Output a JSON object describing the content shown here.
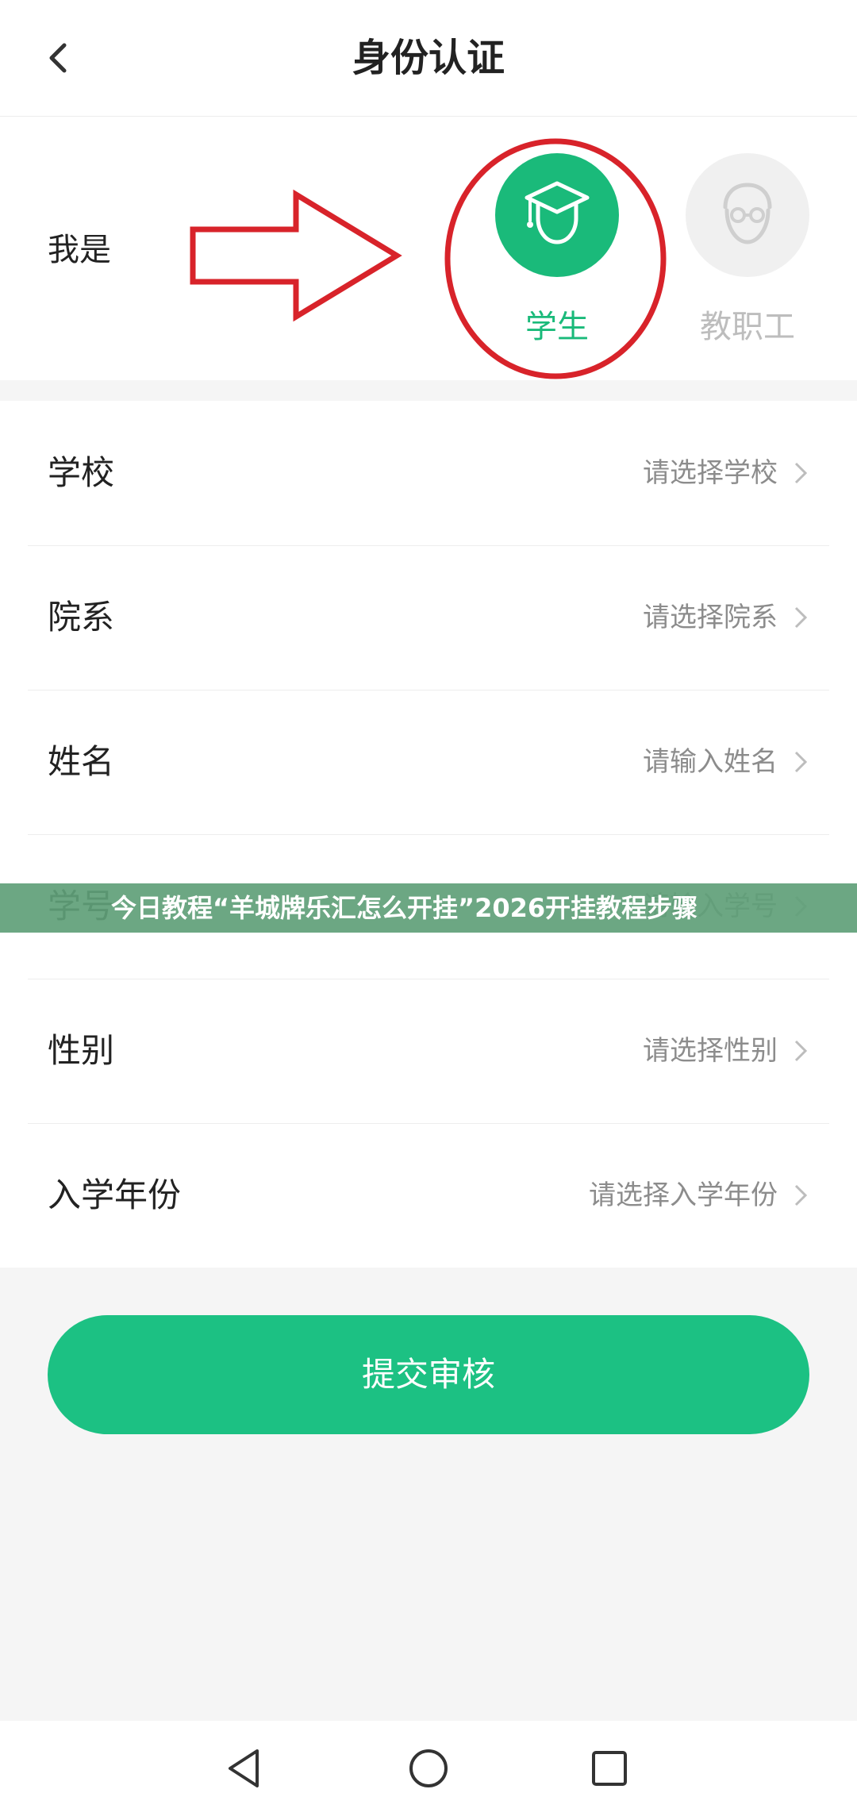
{
  "header": {
    "title": "身份认证"
  },
  "identity": {
    "label": "我是",
    "roles": [
      {
        "label": "学生",
        "selected": true
      },
      {
        "label": "教职工",
        "selected": false
      }
    ]
  },
  "form": {
    "rows": [
      {
        "label": "学校",
        "placeholder": "请选择学校"
      },
      {
        "label": "院系",
        "placeholder": "请选择院系"
      },
      {
        "label": "姓名",
        "placeholder": "请输入姓名"
      },
      {
        "label": "学号",
        "placeholder": "请输入学号"
      },
      {
        "label": "性别",
        "placeholder": "请选择性别"
      },
      {
        "label": "入学年份",
        "placeholder": "请选择入学年份"
      }
    ]
  },
  "banner": {
    "text": "今日教程“羊城牌乐汇怎么开挂”2026开挂教程步骤"
  },
  "submit": {
    "label": "提交审核"
  },
  "colors": {
    "accent": "#1aba7a",
    "button": "#1cc183",
    "annotation": "#d8232a"
  }
}
